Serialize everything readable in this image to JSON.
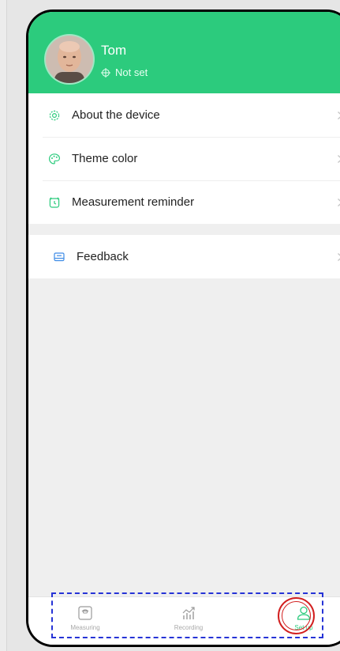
{
  "profile": {
    "name": "Tom",
    "location": "Not set"
  },
  "menu": {
    "items": [
      {
        "label": "About the device",
        "icon": "settings-gear-icon"
      },
      {
        "label": "Theme color",
        "icon": "palette-icon"
      },
      {
        "label": "Measurement reminder",
        "icon": "alarm-clock-icon"
      }
    ],
    "feedback": {
      "label": "Feedback",
      "icon": "feedback-icon"
    }
  },
  "tabbar": {
    "tabs": [
      {
        "label": "Measuring",
        "icon": "scale-icon",
        "active": false
      },
      {
        "label": "Recording",
        "icon": "trend-chart-icon",
        "active": false
      },
      {
        "label": "Set up",
        "icon": "user-icon",
        "active": true
      }
    ]
  },
  "colors": {
    "accent": "#2ccb7d",
    "background": "#efefef",
    "highlight_ring": "#d21f1f",
    "selection_box": "#2633d6"
  }
}
